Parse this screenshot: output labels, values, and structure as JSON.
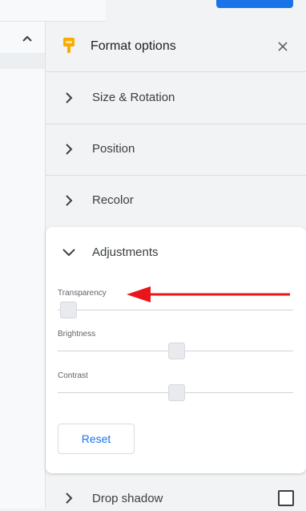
{
  "panel": {
    "title": "Format options",
    "sections": [
      {
        "label": "Size & Rotation"
      },
      {
        "label": "Position"
      },
      {
        "label": "Recolor"
      }
    ],
    "adjustments": {
      "label": "Adjustments",
      "sliders": [
        {
          "label": "Transparency",
          "value_fraction": 0.04
        },
        {
          "label": "Brightness",
          "value_fraction": 0.5
        },
        {
          "label": "Contrast",
          "value_fraction": 0.5
        }
      ],
      "reset_label": "Reset"
    },
    "drop_shadow": {
      "label": "Drop shadow",
      "checked": false
    }
  },
  "colors": {
    "accent": "#1a73e8",
    "header_icon": "#f9ab00",
    "annotation_arrow": "#e8151b"
  },
  "icons": {
    "header": "format-paint-icon",
    "close": "close-icon",
    "collapse": "chevron-up-icon",
    "collapsed_section": "chevron-right-icon",
    "expanded_section": "chevron-down-icon"
  }
}
